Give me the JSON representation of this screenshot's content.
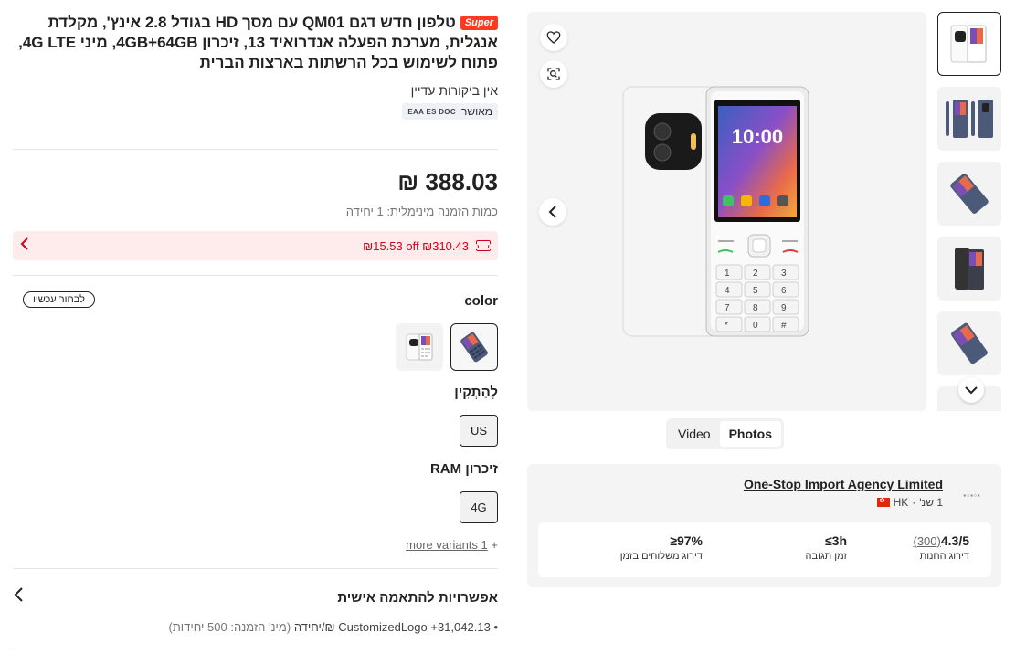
{
  "product": {
    "badge": "Super",
    "title": "טלפון חדש דגם QM01 עם מסך HD בגודל 2.8 אינץ', מקלדת אנגלית, מערכת הפעלה אנדרואיד 13, זיכרון 4GB+64GB, מיני 4G LTE, פתוח לשימוש בכל הרשתות בארצות הברית",
    "reviews": "אין ביקורות עדיין",
    "cert_label": "מאושר",
    "cert_logos": "EAA ES DOC"
  },
  "pricing": {
    "price": "388.03 ₪",
    "moq": "כמות הזמנה מינימלית: 1 יחידה",
    "coupon": "₪15.53 off ₪310.43"
  },
  "variants": {
    "color_label": "color",
    "choose_now": "לבחור עכשיו",
    "plug_label": "לְהַתְקִין",
    "plug_value": "US",
    "ram_label": "זיכרון RAM",
    "ram_value": "4G",
    "more_variants": "1 more variants",
    "more_prefix": "+"
  },
  "customization": {
    "title": "אפשרויות להתאמה אישית",
    "item_name": "CustomizedLogo",
    "item_price": "+31,042.13 ₪/יחידה",
    "item_note": "(מינ' הזמנה: 500 יחידות)"
  },
  "gallery": {
    "screen_time": "10:00",
    "tabs": [
      "Video",
      "Photos"
    ],
    "active_tab": "Photos",
    "keypad": [
      "1",
      "2",
      "3",
      "4",
      "5",
      "6",
      "7",
      "8",
      "9",
      "*",
      "0",
      "#"
    ]
  },
  "supplier": {
    "name": "One-Stop Import Agency Limited",
    "region": "HK",
    "years": "1 שנ'",
    "rating": "4.3/5",
    "rating_count": "(300)",
    "rating_label": "דירוג החנות",
    "response": "≤3h",
    "response_label": "זמן תגובה",
    "ontime": "≥97%",
    "ontime_label": "דירוג משלוחים בזמן"
  },
  "colors": {
    "accent_red": "#d0021b",
    "badge_red": "#ff3b1f",
    "coupon_bg": "#fdeceb"
  }
}
